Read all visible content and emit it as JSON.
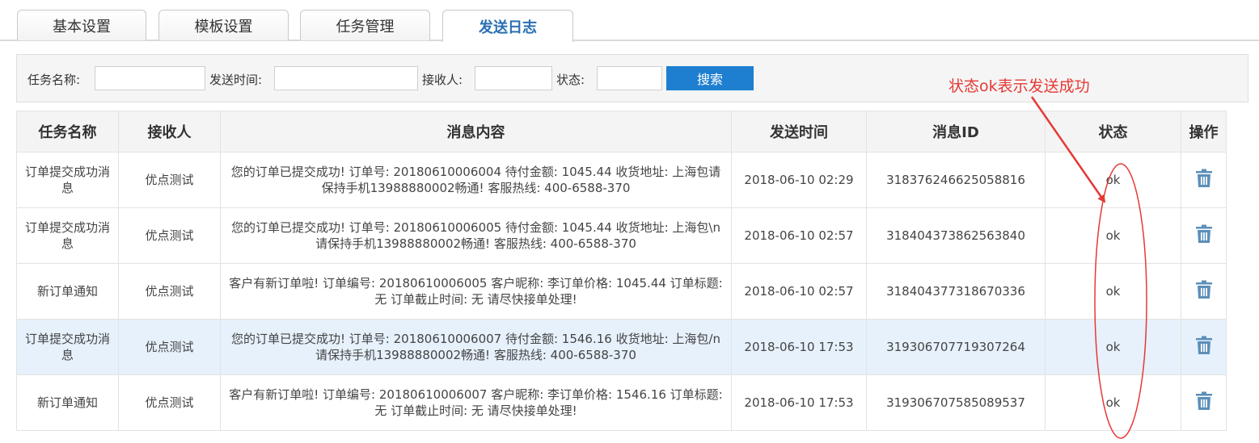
{
  "tabs": [
    {
      "label": "基本设置"
    },
    {
      "label": "模板设置"
    },
    {
      "label": "任务管理"
    },
    {
      "label": "发送日志"
    }
  ],
  "search": {
    "task_name_label": "任务名称:",
    "send_time_label": "发送时间:",
    "receiver_label": "接收人:",
    "status_label": "状态:",
    "task_name_value": "",
    "send_time_value": "",
    "receiver_value": "",
    "status_value": "",
    "search_button": "搜索"
  },
  "annotation": {
    "text": "状态ok表示发送成功",
    "color": "#e53935"
  },
  "table": {
    "headers": [
      "任务名称",
      "接收人",
      "消息内容",
      "发送时间",
      "消息ID",
      "状态",
      "操作"
    ],
    "rows": [
      {
        "task": "订单提交成功消息",
        "receiver": "优点测试",
        "message": "您的订单已提交成功! 订单号: 20180610006004 待付金额: 1045.44 收货地址: 上海包请保持手机13988880002畅通! 客服热线: 400-6588-370",
        "time": "2018-06-10 02:29",
        "msg_id": "318376246625058816",
        "status": "ok"
      },
      {
        "task": "订单提交成功消息",
        "receiver": "优点测试",
        "message": "您的订单已提交成功! 订单号: 20180610006005 待付金额: 1045.44 收货地址: 上海包\\n请保持手机13988880002畅通! 客服热线: 400-6588-370",
        "time": "2018-06-10 02:57",
        "msg_id": "318404373862563840",
        "status": "ok"
      },
      {
        "task": "新订单通知",
        "receiver": "优点测试",
        "message": "客户有新订单啦! 订单编号: 20180610006005 客户昵称: 李订单价格: 1045.44 订单标题: 无 订单截止时间: 无 请尽快接单处理!",
        "time": "2018-06-10 02:57",
        "msg_id": "318404377318670336",
        "status": "ok"
      },
      {
        "task": "订单提交成功消息",
        "receiver": "优点测试",
        "message": "您的订单已提交成功! 订单号: 20180610006007 待付金额: 1546.16 收货地址: 上海包/n请保持手机13988880002畅通! 客服热线: 400-6588-370",
        "time": "2018-06-10 17:53",
        "msg_id": "319306707719307264",
        "status": "ok",
        "highlighted": true
      },
      {
        "task": "新订单通知",
        "receiver": "优点测试",
        "message": "客户有新订单啦! 订单编号: 20180610006007 客户昵称: 李订单价格: 1546.16 订单标题: 无 订单截止时间: 无 请尽快接单处理!",
        "time": "2018-06-10 17:53",
        "msg_id": "319306707585089537",
        "status": "ok"
      }
    ],
    "action_icon": "trash-icon"
  },
  "colors": {
    "active_tab": "#2a6fb4",
    "search_button": "#1e7fd0",
    "highlight_row": "#e6f1fb",
    "trash_icon": "#5b8fb9"
  }
}
